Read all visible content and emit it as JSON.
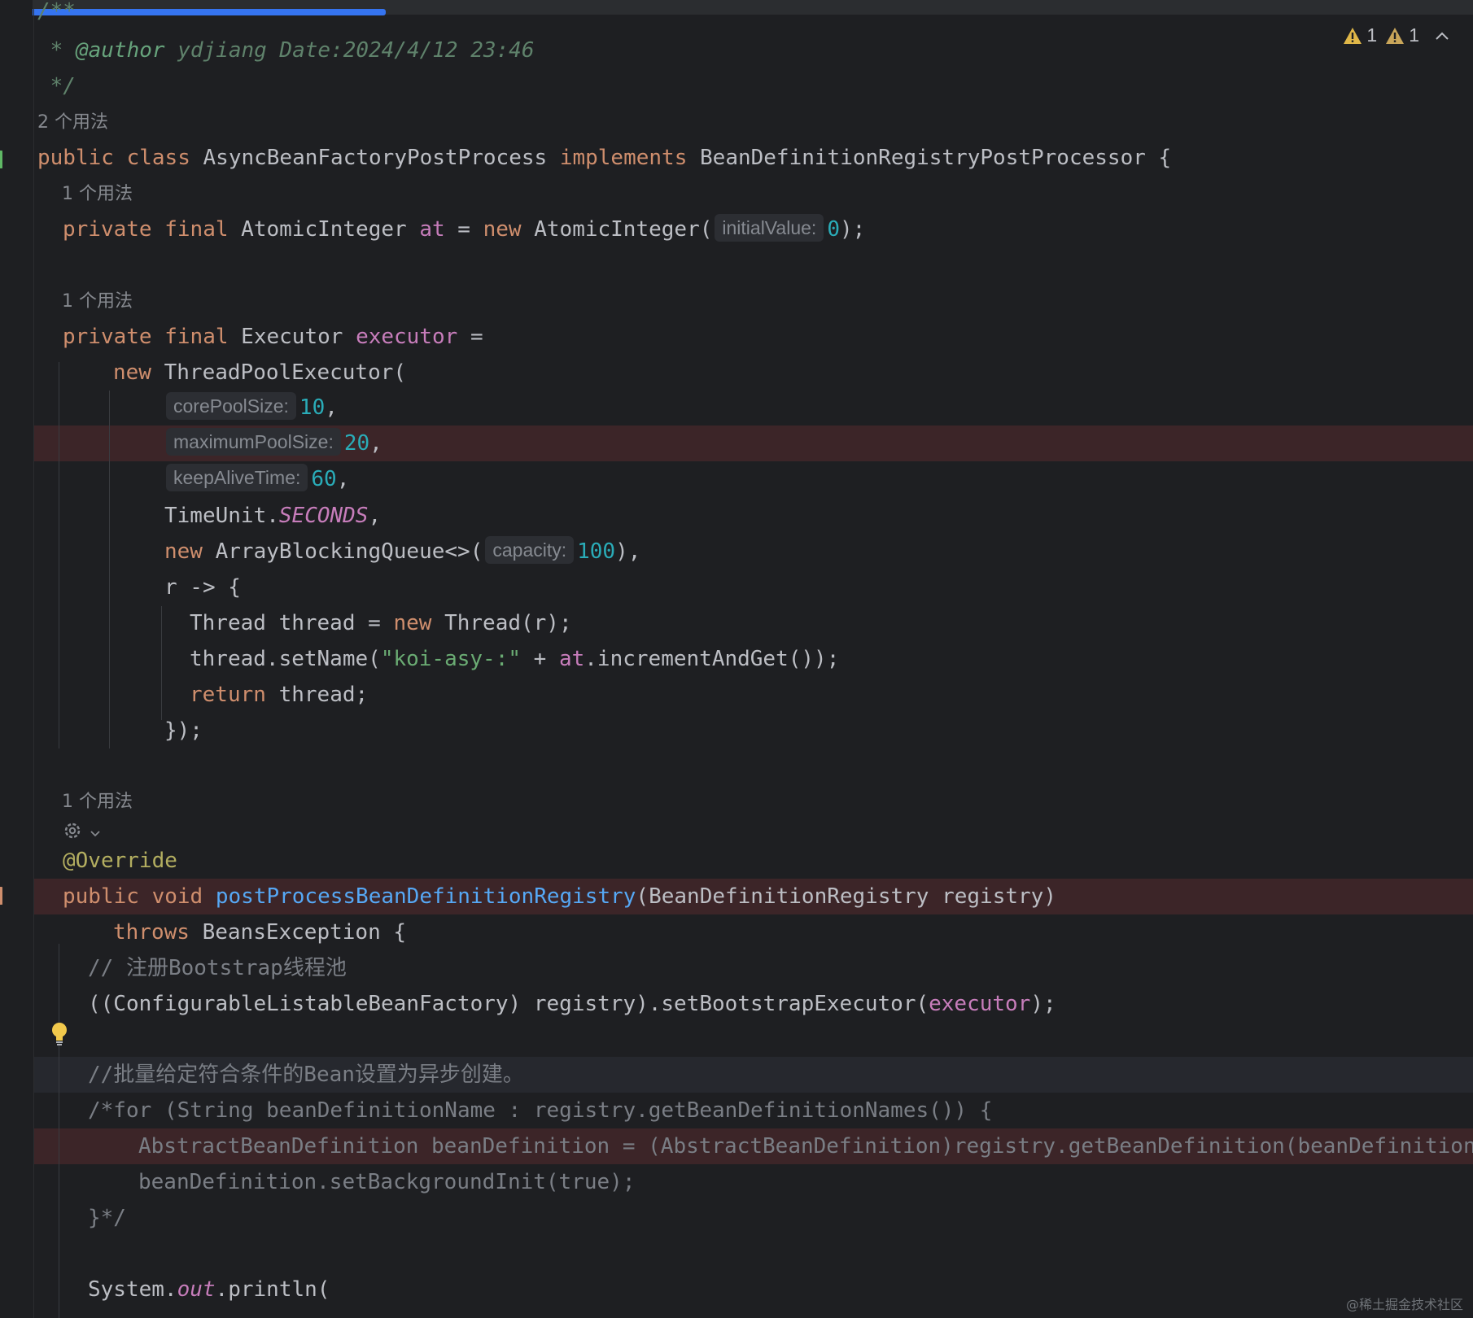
{
  "editor": {
    "inspections": {
      "warning_count_1": "1",
      "warning_count_2": "1"
    },
    "usages": {
      "class_usages": "2 个用法",
      "at_usages": "1 个用法",
      "executor_usages": "1 个用法",
      "method_usages": "1 个用法"
    },
    "hints": {
      "initial_value": "initialValue:",
      "core_pool_size": "corePoolSize:",
      "maximum_pool_size": "maximumPoolSize:",
      "keep_alive_time": "keepAliveTime:",
      "capacity": "capacity:"
    },
    "code": {
      "doc_open": "/**",
      "doc_star": " * ",
      "author_tag": "@author",
      "author_value": " ydjiang Date:2024/4/12 23:46",
      "doc_close": " */",
      "kw_public": "public",
      "kw_class": "class",
      "class_name": "AsyncBeanFactoryPostProcess",
      "kw_implements": "implements",
      "interface_name": "BeanDefinitionRegistryPostProcessor",
      "open_brace": "{",
      "kw_private": "private",
      "kw_final": "final",
      "type_atomic": "AtomicInteger",
      "field_at": "at",
      "assign": " = ",
      "kw_new": "new",
      "ctor_atomic": "AtomicInteger(",
      "num_zero": "0",
      "close_stmt": ");",
      "type_executor": "Executor",
      "field_executor": "executor",
      "assign_trail": " =",
      "ctor_tpe": "ThreadPoolExecutor(",
      "num_10": "10",
      "num_20": "20",
      "num_60": "60",
      "comma": ",",
      "timeunit": "TimeUnit.",
      "seconds": "SECONDS",
      "abq": "ArrayBlockingQueue<>(",
      "num_100": "100",
      "close_comma": "),",
      "lambda": "r -> {",
      "thread_decl": "Thread thread = ",
      "thread_ctor": "Thread(r);",
      "set_name": "thread.setName(",
      "str_koi": "\"koi-asy-:\"",
      "plus": " + ",
      "incr": ".incrementAndGet());",
      "kw_return": "return",
      "return_val": " thread;",
      "close_lambda": "});",
      "override": "@Override",
      "kw_void": "void",
      "method_name": "postProcessBeanDefinitionRegistry",
      "method_params": "(BeanDefinitionRegistry registry)",
      "kw_throws": "throws",
      "throws_tail": " BeansException {",
      "cmt_register": "// 注册Bootstrap线程池",
      "cast_call": "((ConfigurableListableBeanFactory) registry).setBootstrapExecutor(",
      "cmt_batch": "//批量给定符合条件的Bean设置为异步创建。",
      "cmt_for": "/*for (String beanDefinitionName : registry.getBeanDefinitionNames()) {",
      "cmt_abd": "AbstractBeanDefinition beanDefinition = (AbstractBeanDefinition)registry.getBeanDefinition(beanDefinitionName);",
      "cmt_setbg": "beanDefinition.setBackgroundInit(true);",
      "cmt_close": "}*/",
      "sysout": "System.",
      "out": "out",
      "println": ".println("
    },
    "watermark": "@稀土掘金技术社区"
  },
  "colors": {
    "background": "#1e1f22",
    "keyword": "#cf8e6d",
    "field": "#c77dbb",
    "number": "#2aacb8",
    "string": "#6aab73",
    "method": "#56a8f5",
    "annotation": "#b3ae60",
    "comment": "#7a7e85",
    "accent": "#3574f0",
    "error_line": "#3c2528"
  },
  "icons": [
    "warning-icon",
    "chevron-up-icon",
    "gear-icon",
    "chevron-down-icon",
    "lightbulb-icon"
  ]
}
